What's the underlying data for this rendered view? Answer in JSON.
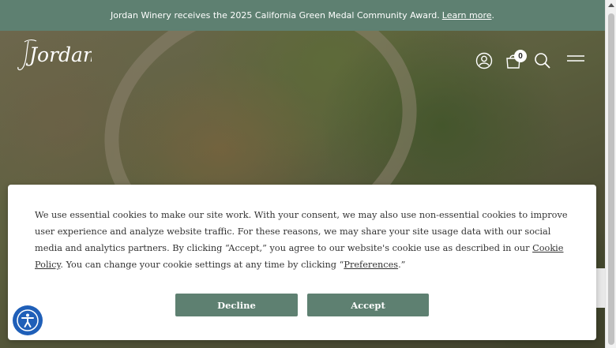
{
  "announcement": {
    "text": "Jordan Winery receives the 2025 California Green Medal Community Award.",
    "link": "Learn more",
    "suffix": "."
  },
  "header": {
    "logo_text": "Jordan",
    "icons": [
      "account-icon",
      "cart-icon",
      "search-icon",
      "menu-icon"
    ],
    "cart_count": "0"
  },
  "cookie_banner": {
    "text_1": "We use essential cookies to make our site work. With your consent, we may also use non-essential cookies to improve user experience and analyze website traffic. For these reasons, we may share your site usage data with our social media and analytics partners. By clicking “Accept,” you agree to our website's cookie use as described in our ",
    "cookie_policy_link": "Cookie Policy",
    "text_2": ". You can change your cookie settings at any time by clicking “",
    "preferences_link": "Preferences",
    "text_3": ".”",
    "decline_label": "Decline",
    "accept_label": "Accept"
  },
  "accessibility": {
    "icon": "accessibility-icon"
  },
  "colors": {
    "brand_green": "#5e8071",
    "accessibility_blue": "#1f5fb8"
  }
}
